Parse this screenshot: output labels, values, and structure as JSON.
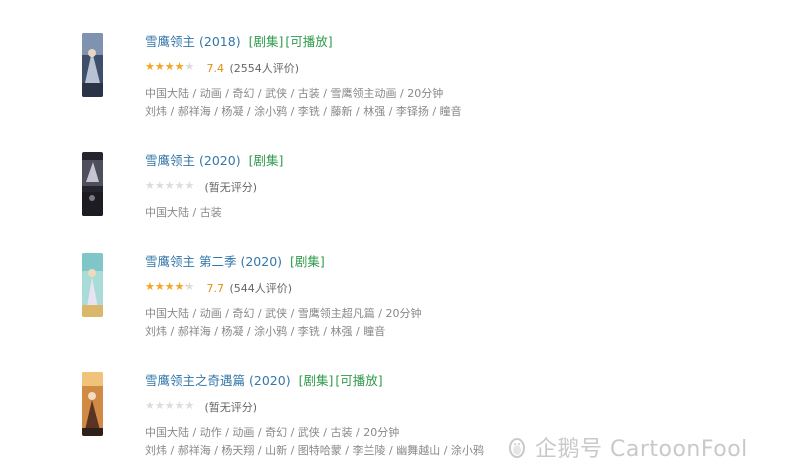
{
  "results": [
    {
      "title": "雪鹰领主",
      "year": "(2018)",
      "tags": [
        "[剧集]",
        "[可播放]"
      ],
      "rating": {
        "stars_fraction": 0.74,
        "score": "7.4",
        "count": "(2554人评价)"
      },
      "meta": "中国大陆 / 动画 / 奇幻 / 武侠 / 古装 / 雪鹰领主动画 / 20分钟",
      "cast": "刘炜 / 郝祥海 / 杨凝 / 涂小鸦 / 李铣 / 藤新 / 林强 / 李铎扬 / 瞳音",
      "poster_colors": [
        "#4a5a75",
        "#8a9ab5",
        "#c0c8d8"
      ]
    },
    {
      "title": "雪鹰领主",
      "year": "(2020)",
      "tags": [
        "[剧集]"
      ],
      "rating": {
        "stars_fraction": 0,
        "score": "",
        "count": "(暂无评分)"
      },
      "meta": "中国大陆 / 古装",
      "cast": "",
      "poster_colors": [
        "#2a2a30",
        "#6a6a78",
        "#d8d8e0"
      ]
    },
    {
      "title": "雪鹰领主 第二季",
      "year": "(2020)",
      "tags": [
        "[剧集]"
      ],
      "rating": {
        "stars_fraction": 0.77,
        "score": "7.7",
        "count": "(544人评价)"
      },
      "meta": "中国大陆 / 动画 / 奇幻 / 武侠 / 雪鹰领主超凡篇 / 20分钟",
      "cast": "刘炜 / 郝祥海 / 杨凝 / 涂小鸦 / 李铣 / 林强 / 瞳音",
      "poster_colors": [
        "#7fc6c8",
        "#b9e0d8",
        "#e0c890"
      ]
    },
    {
      "title": "雪鹰领主之奇遇篇",
      "year": "(2020)",
      "tags": [
        "[剧集]",
        "[可播放]"
      ],
      "rating": {
        "stars_fraction": 0,
        "score": "",
        "count": "(暂无评分)"
      },
      "meta": "中国大陆 / 动作 / 动画 / 奇幻 / 武侠 / 古装 / 20分钟",
      "cast": "刘炜 / 郝祥海 / 杨天翔 / 山新 / 图特哈蒙 / 李兰陵 / 幽舞越山 / 涂小鸦",
      "poster_colors": [
        "#b55a2a",
        "#e0a050",
        "#3a2a20"
      ]
    }
  ],
  "watermark": {
    "text": "企鹅号 CartoonFool",
    "icon": "penguin-icon"
  },
  "colors": {
    "link": "#3377aa",
    "tag": "#2f9a4b",
    "star": "#f5a623",
    "score": "#e09015",
    "meta": "#888888"
  }
}
